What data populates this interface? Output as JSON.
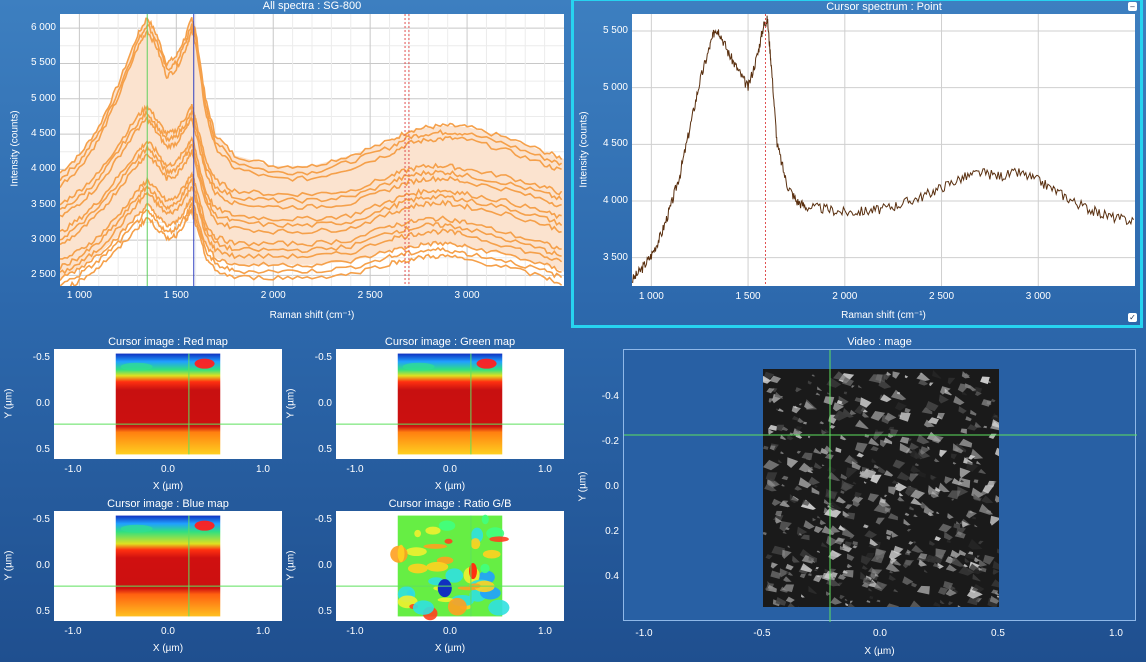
{
  "panels": {
    "all_spectra": {
      "title": "All spectra : SG-800",
      "xlabel": "Raman shift (cm⁻¹)",
      "ylabel": "Intensity (counts)",
      "xticks": [
        "1 000",
        "1 500",
        "2 000",
        "2 500",
        "3 000"
      ],
      "yticks": [
        "6 000",
        "5 500",
        "5 000",
        "4 500",
        "4 000",
        "3 500",
        "3 000",
        "2 500"
      ]
    },
    "cursor_spectrum": {
      "title": "Cursor spectrum : Point",
      "xlabel": "Raman shift (cm⁻¹)",
      "ylabel": "Intensity (counts)",
      "xticks": [
        "1 000",
        "1 500",
        "2 000",
        "2 500",
        "3 000"
      ],
      "yticks": [
        "5 500",
        "5 000",
        "4 500",
        "4 000",
        "3 500"
      ]
    },
    "red_map": {
      "title": "Cursor image : Red map",
      "xlabel": "X (µm)",
      "ylabel": "Y (µm)"
    },
    "green_map": {
      "title": "Cursor image : Green map",
      "xlabel": "X (µm)",
      "ylabel": "Y (µm)"
    },
    "blue_map": {
      "title": "Cursor image : Blue map",
      "xlabel": "X (µm)",
      "ylabel": "Y (µm)"
    },
    "ratio_map": {
      "title": "Cursor image : Ratio G/B",
      "xlabel": "X (µm)",
      "ylabel": "Y (µm)"
    },
    "video": {
      "title": "Video : mage",
      "xlabel": "X (µm)",
      "ylabel": "Y (µm)",
      "xticks": [
        "-1.0",
        "-0.5",
        "0.0",
        "0.5",
        "1.0"
      ],
      "yticks": [
        "-0.4",
        "-0.2",
        "0.0",
        "0.2",
        "0.4"
      ]
    }
  },
  "map_ticks": {
    "x": [
      "-1.0",
      "0.0",
      "1.0"
    ],
    "y": [
      "-0.5",
      "0.0",
      "0.5"
    ]
  },
  "colors": {
    "spectra": "#f5a04a",
    "spectra_fill": "#fbe3cf",
    "cursor_spectrum": "#5a3010",
    "cursor_line_red": "#e05050",
    "cursor_line_green": "#60d060",
    "cursor_line_blue": "#3040c0",
    "selected_outline": "#27d3f0"
  },
  "chart_data": [
    {
      "type": "line",
      "title": "All spectra : SG-800",
      "xlabel": "Raman shift (cm⁻¹)",
      "ylabel": "Intensity (counts)",
      "xlim": [
        900,
        3500
      ],
      "ylim": [
        2350,
        6200
      ],
      "x": [
        900,
        1000,
        1100,
        1200,
        1300,
        1350,
        1400,
        1450,
        1500,
        1550,
        1580,
        1600,
        1650,
        1700,
        1800,
        2000,
        2200,
        2400,
        2600,
        2700,
        2800,
        2900,
        3000,
        3200,
        3400,
        3500
      ],
      "series": [
        {
          "values": [
            3950,
            4200,
            4600,
            5200,
            5900,
            6150,
            5900,
            5500,
            5600,
            5900,
            6150,
            5950,
            5000,
            4500,
            4200,
            4050,
            4050,
            4200,
            4400,
            4550,
            4600,
            4620,
            4600,
            4450,
            4250,
            4150
          ]
        },
        {
          "values": [
            3500,
            3700,
            3950,
            4350,
            4750,
            4900,
            4700,
            4500,
            4550,
            4750,
            4900,
            4700,
            4150,
            3850,
            3700,
            3650,
            3650,
            3700,
            3900,
            4000,
            4050,
            4050,
            4000,
            3900,
            3750,
            3650
          ]
        },
        {
          "values": [
            3100,
            3300,
            3550,
            3900,
            4250,
            4400,
            4250,
            4050,
            4100,
            4300,
            4450,
            4250,
            3700,
            3450,
            3350,
            3300,
            3300,
            3350,
            3550,
            3650,
            3700,
            3700,
            3650,
            3550,
            3400,
            3300
          ]
        },
        {
          "values": [
            2700,
            2850,
            3050,
            3350,
            3700,
            3850,
            3700,
            3550,
            3600,
            3800,
            3950,
            3750,
            3250,
            3050,
            2950,
            2950,
            2950,
            3000,
            3200,
            3250,
            3300,
            3300,
            3250,
            3100,
            2950,
            2850
          ]
        },
        {
          "values": [
            2450,
            2600,
            2800,
            3050,
            3350,
            3500,
            3350,
            3200,
            3250,
            3450,
            3600,
            3400,
            2950,
            2750,
            2650,
            2650,
            2650,
            2700,
            2850,
            2900,
            2950,
            2950,
            2900,
            2800,
            2650,
            2550
          ]
        }
      ],
      "markers_x": [
        1350,
        1590,
        2680,
        2700
      ]
    },
    {
      "type": "line",
      "title": "Cursor spectrum : Point",
      "xlabel": "Raman shift (cm⁻¹)",
      "ylabel": "Intensity (counts)",
      "xlim": [
        900,
        3500
      ],
      "ylim": [
        3250,
        5650
      ],
      "series": [
        {
          "x": [
            900,
            950,
            1000,
            1050,
            1100,
            1150,
            1200,
            1250,
            1300,
            1330,
            1350,
            1400,
            1450,
            1500,
            1550,
            1580,
            1600,
            1620,
            1650,
            1700,
            1750,
            1800,
            1900,
            2000,
            2100,
            2200,
            2300,
            2400,
            2500,
            2600,
            2700,
            2800,
            2900,
            3000,
            3100,
            3200,
            3300,
            3400,
            3500
          ],
          "values": [
            3300,
            3400,
            3520,
            3700,
            3950,
            4250,
            4650,
            5050,
            5350,
            5520,
            5500,
            5300,
            5150,
            5000,
            5300,
            5550,
            5600,
            5200,
            4500,
            4150,
            4000,
            3950,
            3930,
            3900,
            3910,
            3930,
            3980,
            4040,
            4120,
            4200,
            4250,
            4220,
            4250,
            4180,
            4080,
            3980,
            3900,
            3850,
            3820
          ]
        }
      ],
      "markers_x": [
        1590
      ]
    }
  ]
}
